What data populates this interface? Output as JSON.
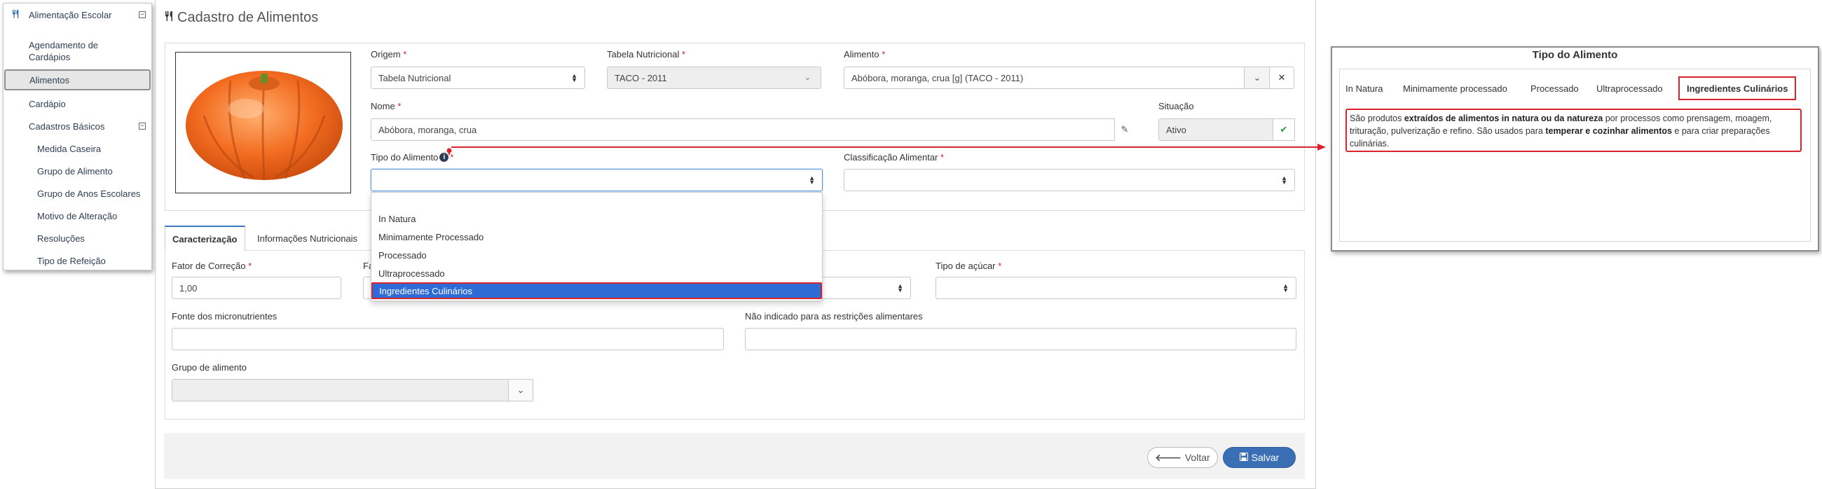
{
  "sidebar": {
    "module": "Alimentação Escolar",
    "module_toggle": "−",
    "items": [
      {
        "label": "Agendamento de Cardápios"
      },
      {
        "label": "Alimentos"
      },
      {
        "label": "Cardápio"
      },
      {
        "label": "Cadastros Básicos"
      }
    ],
    "subitems": [
      {
        "label": "Medida Caseira"
      },
      {
        "label": "Grupo de Alimento"
      },
      {
        "label": "Grupo de Anos Escolares"
      },
      {
        "label": "Motivo de Alteração"
      },
      {
        "label": "Resoluções"
      },
      {
        "label": "Tipo de Refeição"
      }
    ]
  },
  "page": {
    "title": "Cadastro de Alimentos"
  },
  "form": {
    "origem": {
      "label": "Origem",
      "value": "Tabela Nutricional"
    },
    "tabela": {
      "label": "Tabela Nutricional",
      "value": "TACO - 2011"
    },
    "alimento": {
      "label": "Alimento",
      "value": "Abóbora, moranga, crua [g] (TACO - 2011)"
    },
    "nome": {
      "label": "Nome",
      "value": "Abóbora, moranga, crua"
    },
    "situacao": {
      "label": "Situação",
      "value": "Ativo"
    },
    "tipo": {
      "label": "Tipo do Alimento",
      "value": ""
    },
    "classificacao": {
      "label": "Classificação Alimentar",
      "value": ""
    },
    "required_mark": "*"
  },
  "dropdown": {
    "options": [
      "In Natura",
      "Minimamente Processado",
      "Processado",
      "Ultraprocessado"
    ],
    "selected": "Ingredientes Culinários"
  },
  "tabs": [
    {
      "label": "Caracterização"
    },
    {
      "label": "Informações Nutricionais"
    }
  ],
  "caracterizacao": {
    "fator": {
      "label": "Fator de Correção",
      "value": "1,00"
    },
    "fa_partial": "Fa",
    "acucar": {
      "label": "Tipo de açúcar",
      "value": ""
    },
    "fonte": {
      "label": "Fonte dos micronutrientes",
      "value": ""
    },
    "restricoes": {
      "label": "Não indicado para as restrições alimentares",
      "value": ""
    },
    "grupo": {
      "label": "Grupo de alimento",
      "value": ""
    }
  },
  "buttons": {
    "voltar": "Voltar",
    "salvar": "Salvar"
  },
  "info_panel": {
    "title": "Tipo do Alimento",
    "tabs": [
      "In Natura",
      "Minimamente processado",
      "Processado",
      "Ultraprocessado",
      "Ingredientes Culinários"
    ],
    "desc": {
      "p1": "São produtos ",
      "b1": "extraídos de alimentos in natura ou da natureza",
      "p2": " por processos como prensagem, moagem, trituração, pulverização e refino. São usados para ",
      "b2": "temperar e cozinhar alimentos",
      "p3": " e para criar preparações culinárias."
    }
  },
  "colors": {
    "accent": "#3a6fb5",
    "highlight": "#d9232d",
    "selected_option": "#2e6bd6"
  }
}
